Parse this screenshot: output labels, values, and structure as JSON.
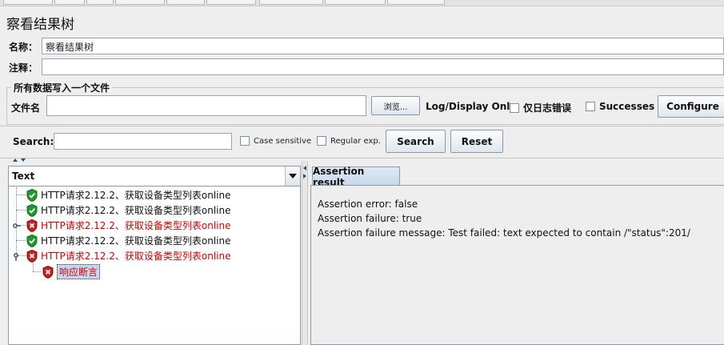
{
  "window": {
    "title": "察看结果树"
  },
  "form": {
    "name_label": "名称：",
    "name_value": "察看结果树",
    "comment_label": "注释：",
    "comment_value": ""
  },
  "file_group": {
    "title": "所有数据写入一个文件",
    "filename_label": "文件名",
    "filename_value": "",
    "browse_label": "浏览...",
    "log_display_label": "Log/Display Only:",
    "errors_only_label": "仅日志错误",
    "successes_label": "Successes",
    "configure_label": "Configure"
  },
  "search": {
    "label": "Search:",
    "value": "",
    "case_sensitive_label": "Case sensitive",
    "regex_label": "Regular exp.",
    "search_button": "Search",
    "reset_button": "Reset"
  },
  "tree": {
    "renderer_selected": "Text",
    "items": [
      {
        "label": "HTTP请求2.12.2、获取设备类型列表online",
        "status": "pass"
      },
      {
        "label": "HTTP请求2.12.2、获取设备类型列表online",
        "status": "pass"
      },
      {
        "label": "HTTP请求2.12.2、获取设备类型列表online",
        "status": "fail"
      },
      {
        "label": "HTTP请求2.12.2、获取设备类型列表online",
        "status": "pass"
      },
      {
        "label": "HTTP请求2.12.2、获取设备类型列表online",
        "status": "fail"
      }
    ],
    "child": {
      "label": "响应断言",
      "status": "fail"
    }
  },
  "result": {
    "tab_label": "Assertion result",
    "lines": [
      "Assertion error: false",
      "Assertion failure: true",
      "Assertion failure message: Test failed: text expected to contain /\"status\":201/"
    ]
  },
  "colors": {
    "fail_text": "#d40000",
    "pass_shield": "#1f9a2c",
    "fail_shield": "#c62020"
  }
}
